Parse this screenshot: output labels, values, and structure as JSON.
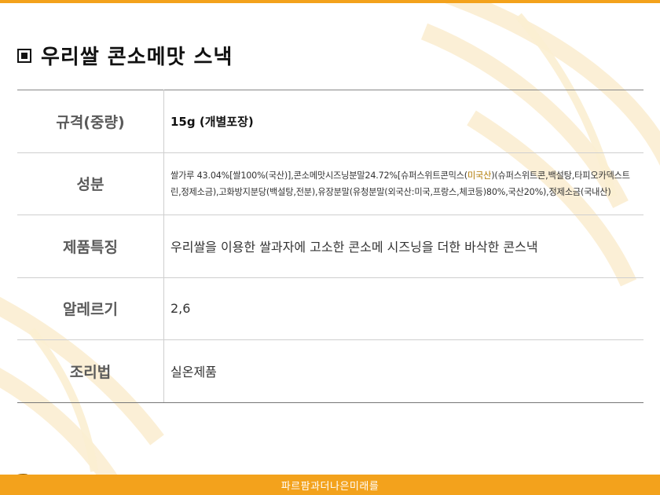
{
  "title": "우리쌀 콘소메맛 스낵",
  "title_icon": "square-bullet-icon",
  "colors": {
    "accent": "#f3a21c",
    "highlight": "#b07800",
    "label": "#5a5a5a"
  },
  "rows": [
    {
      "label": "규격(중량)",
      "value": "15g (개별포장)"
    },
    {
      "label": "성분",
      "value_part1": "쌀가루 43.04%[쌀100%(국산)],콘소메맛시즈닝분말24.72%[슈퍼스위트콘믹스(",
      "value_highlight": "미국산",
      "value_part2": ")(슈퍼스위트콘,백설탕,타피오카덱스트린,정제소금),고화방지분당(백설탕,전분),유장분말(유청분말(외국산:미국,프랑스,체코등)80%,국산20%),정제소금(국내산)"
    },
    {
      "label": "제품특징",
      "value": "우리쌀을 이용한 쌀과자에 고소한 콘소메 시즈닝을 더한 바삭한 콘스낵"
    },
    {
      "label": "알레르기",
      "value": "2,6"
    },
    {
      "label": "조리법",
      "value": "실온제품"
    }
  ],
  "footer": "파르팜과더나은미래를"
}
